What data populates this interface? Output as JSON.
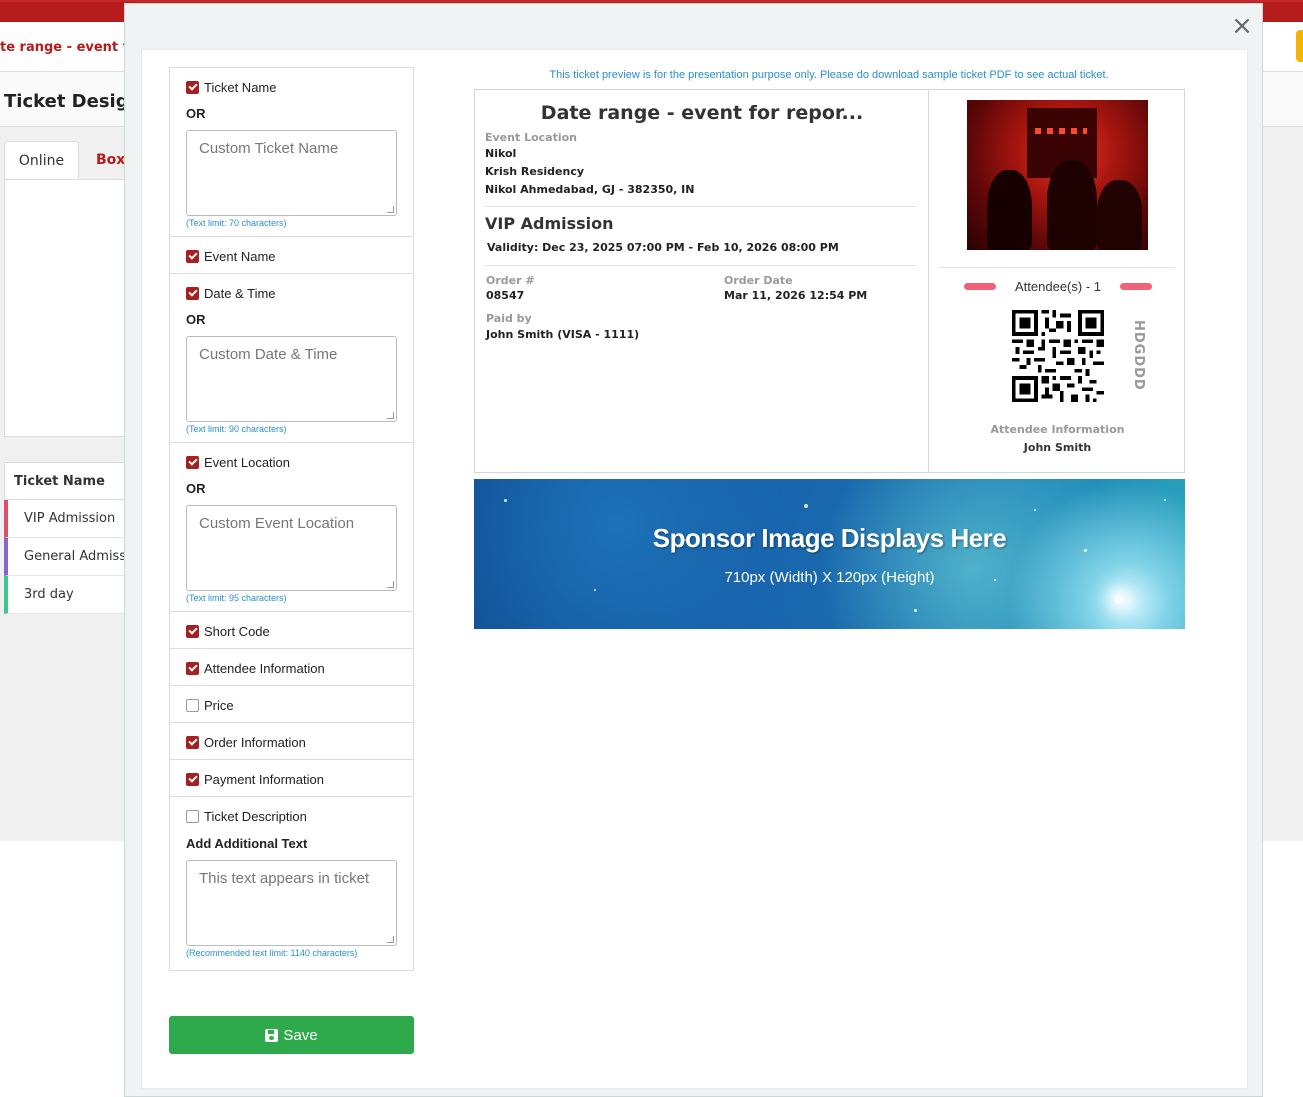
{
  "background": {
    "event_title_partial": "te range - event for",
    "page_heading": "Ticket Design",
    "tabs": [
      {
        "label": "Online"
      },
      {
        "label": "Box"
      }
    ],
    "ticket_table": {
      "header": "Ticket Name",
      "rows": [
        {
          "label": "VIP Admission",
          "accent": "#e0506a"
        },
        {
          "label": "General Admission",
          "accent": "#8a63d2"
        },
        {
          "label": "3rd day",
          "accent": "#3cc98a"
        }
      ]
    }
  },
  "modal": {
    "close_label": "×",
    "settings": {
      "ticket_name": {
        "label": "Ticket Name",
        "checked": true,
        "or": "OR",
        "placeholder": "Custom Ticket Name",
        "limit": "(Text limit: 70 characters)"
      },
      "event_name": {
        "label": "Event Name",
        "checked": true
      },
      "date_time": {
        "label": "Date & Time",
        "checked": true,
        "or": "OR",
        "placeholder": "Custom Date & Time",
        "limit": "(Text limit: 90 characters)"
      },
      "event_location": {
        "label": "Event Location",
        "checked": true,
        "or": "OR",
        "placeholder": "Custom Event Location",
        "limit": "(Text limit: 95 characters)"
      },
      "short_code": {
        "label": "Short Code",
        "checked": true
      },
      "attendee_info": {
        "label": "Attendee Information",
        "checked": true
      },
      "price": {
        "label": "Price",
        "checked": false
      },
      "order_info": {
        "label": "Order Information",
        "checked": true
      },
      "payment_info": {
        "label": "Payment Information",
        "checked": true
      },
      "ticket_description": {
        "label": "Ticket Description",
        "checked": false
      },
      "additional_text": {
        "label": "Add Additional Text",
        "placeholder": "This text appears in ticket",
        "limit": "(Recommended text limit: 1140 characters)"
      }
    },
    "save_label": "Save",
    "preview": {
      "note": "This ticket preview is for the presentation purpose only. Please do download sample ticket PDF to see actual ticket.",
      "event_title": "Date range - event for repor...",
      "location_label": "Event Location",
      "location_lines": [
        "Nikol",
        "Krish Residency",
        "Nikol Ahmedabad, GJ - 382350, IN"
      ],
      "admission": "VIP Admission",
      "validity": "Validity: Dec 23, 2025 07:00 PM - Feb 10, 2026 08:00 PM",
      "order_label": "Order #",
      "order_value": "08547",
      "order_date_label": "Order Date",
      "order_date_value": "Mar 11, 2026 12:54 PM",
      "paid_label": "Paid by",
      "paid_value": "John Smith (VISA - 1111)",
      "attendee_count": "Attendee(s) - 1",
      "short_code": "HDGDDD",
      "attendee_info_label": "Attendee Information",
      "attendee_name": "John Smith",
      "accent": "#f06277"
    },
    "sponsor": {
      "title": "Sponsor Image Displays Here",
      "subtitle": "710px (Width) X 120px (Height)"
    }
  },
  "colors": {
    "brand_red": "#a52121",
    "save_green": "#2eaa4c",
    "link_blue": "#2a8fd0"
  }
}
